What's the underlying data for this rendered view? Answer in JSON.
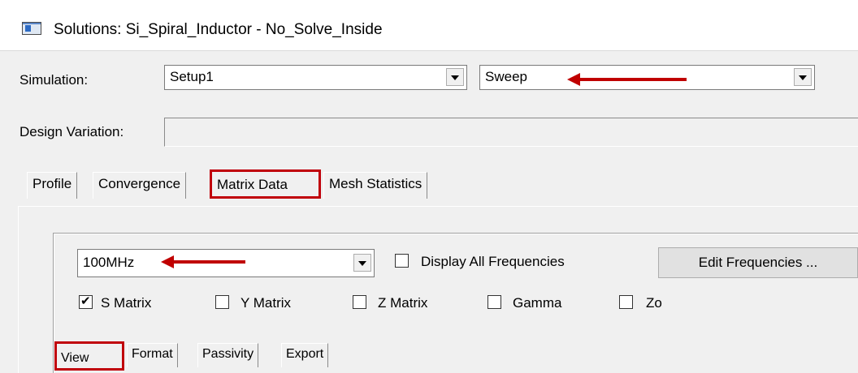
{
  "window": {
    "title": "Solutions: Si_Spiral_Inductor - No_Solve_Inside"
  },
  "simulation": {
    "label": "Simulation:",
    "setup_value": "Setup1",
    "sweep_value": "Sweep"
  },
  "design_variation": {
    "label": "Design Variation:",
    "value": ""
  },
  "tabs": [
    "Profile",
    "Convergence",
    "Matrix Data",
    "Mesh Statistics"
  ],
  "selected_tab": "Matrix Data",
  "matrix_data": {
    "frequency_value": "100MHz",
    "display_all_frequencies": {
      "label": "Display All Frequencies",
      "checked": false
    },
    "edit_frequencies_label": "Edit Frequencies ...",
    "matrices": [
      {
        "label": "S Matrix",
        "checked": true
      },
      {
        "label": "Y Matrix",
        "checked": false
      },
      {
        "label": "Z Matrix",
        "checked": false
      },
      {
        "label": "Gamma",
        "checked": false
      },
      {
        "label": "Zo",
        "checked": false
      }
    ],
    "subtabs": [
      "View",
      "Format",
      "Passivity",
      "Export"
    ],
    "selected_subtab": "View"
  },
  "colors": {
    "highlight": "#c0000a",
    "arrow": "#c00000"
  }
}
